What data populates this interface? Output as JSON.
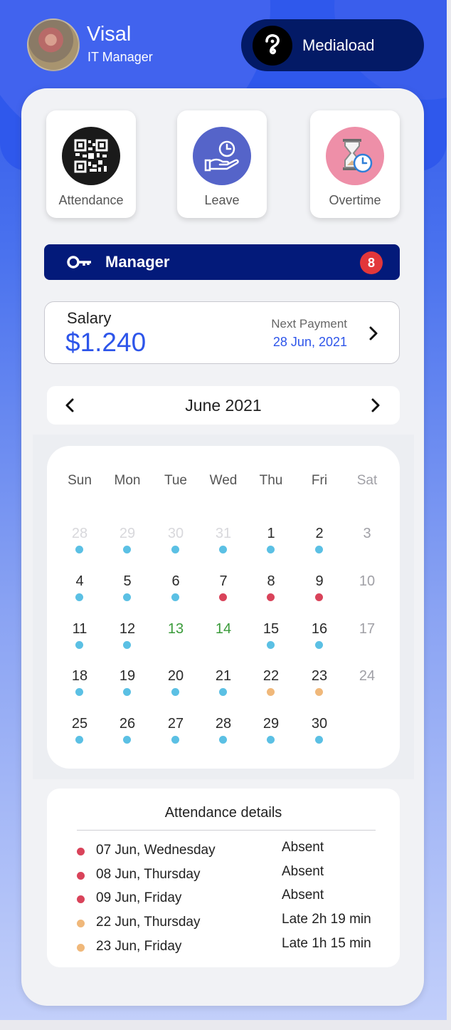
{
  "user": {
    "name": "Visal",
    "role": "IT Manager"
  },
  "org": {
    "name": "Mediaload"
  },
  "quick_actions": [
    {
      "label": "Attendance",
      "icon": "qr-code-icon"
    },
    {
      "label": "Leave",
      "icon": "hand-clock-icon"
    },
    {
      "label": "Overtime",
      "icon": "hourglass-icon"
    }
  ],
  "manager": {
    "label": "Manager",
    "badge": "8"
  },
  "salary": {
    "label": "Salary",
    "amount": "$1.240",
    "next_label": "Next Payment",
    "next_date": "28 Jun, 2021"
  },
  "calendar": {
    "month": "June 2021",
    "weekdays": [
      "Sun",
      "Mon",
      "Tue",
      "Wed",
      "Thu",
      "Fri",
      "Sat"
    ],
    "weeks": [
      [
        {
          "d": "28",
          "s": "other",
          "m": "present"
        },
        {
          "d": "29",
          "s": "other",
          "m": "present"
        },
        {
          "d": "30",
          "s": "other",
          "m": "present"
        },
        {
          "d": "31",
          "s": "other",
          "m": "present"
        },
        {
          "d": "1",
          "s": "normal",
          "m": "present"
        },
        {
          "d": "2",
          "s": "normal",
          "m": "present"
        },
        {
          "d": "3",
          "s": "weekend",
          "m": ""
        }
      ],
      [
        {
          "d": "4",
          "s": "normal",
          "m": "present"
        },
        {
          "d": "5",
          "s": "normal",
          "m": "present"
        },
        {
          "d": "6",
          "s": "normal",
          "m": "present"
        },
        {
          "d": "7",
          "s": "normal",
          "m": "absent"
        },
        {
          "d": "8",
          "s": "normal",
          "m": "absent"
        },
        {
          "d": "9",
          "s": "normal",
          "m": "absent"
        },
        {
          "d": "10",
          "s": "weekend",
          "m": ""
        }
      ],
      [
        {
          "d": "11",
          "s": "normal",
          "m": "present"
        },
        {
          "d": "12",
          "s": "normal",
          "m": "present"
        },
        {
          "d": "13",
          "s": "holiday",
          "m": ""
        },
        {
          "d": "14",
          "s": "holiday",
          "m": ""
        },
        {
          "d": "15",
          "s": "normal",
          "m": "present"
        },
        {
          "d": "16",
          "s": "normal",
          "m": "present"
        },
        {
          "d": "17",
          "s": "weekend",
          "m": ""
        }
      ],
      [
        {
          "d": "18",
          "s": "normal",
          "m": "present"
        },
        {
          "d": "19",
          "s": "normal",
          "m": "present"
        },
        {
          "d": "20",
          "s": "normal",
          "m": "present"
        },
        {
          "d": "21",
          "s": "normal",
          "m": "present"
        },
        {
          "d": "22",
          "s": "normal",
          "m": "late"
        },
        {
          "d": "23",
          "s": "normal",
          "m": "late"
        },
        {
          "d": "24",
          "s": "weekend",
          "m": ""
        }
      ],
      [
        {
          "d": "25",
          "s": "normal",
          "m": "present"
        },
        {
          "d": "26",
          "s": "normal",
          "m": "present"
        },
        {
          "d": "27",
          "s": "normal",
          "m": "present"
        },
        {
          "d": "28",
          "s": "normal",
          "m": "present"
        },
        {
          "d": "29",
          "s": "normal",
          "m": "present"
        },
        {
          "d": "30",
          "s": "normal",
          "m": "present"
        },
        {
          "d": "",
          "s": "empty",
          "m": ""
        }
      ]
    ]
  },
  "colors": {
    "present": "#5bc0e4",
    "absent": "#d9435a",
    "late": "#f0b87a",
    "holiday": "#3a9b3a",
    "accent": "#2d55ea",
    "other": "#d8d8dc",
    "weekend": "#a0a0a6",
    "normal": "#2a2a2a"
  },
  "attendance_details": {
    "title": "Attendance details",
    "rows": [
      {
        "date": "07 Jun, Wednesday",
        "status": "Absent",
        "type": "absent"
      },
      {
        "date": "08 Jun, Thursday",
        "status": "Absent",
        "type": "absent"
      },
      {
        "date": "09 Jun, Friday",
        "status": "Absent",
        "type": "absent"
      },
      {
        "date": "22 Jun, Thursday",
        "status": "Late 2h 19 min",
        "type": "late"
      },
      {
        "date": "23 Jun, Friday",
        "status": "Late 1h 15 min",
        "type": "late"
      }
    ]
  }
}
